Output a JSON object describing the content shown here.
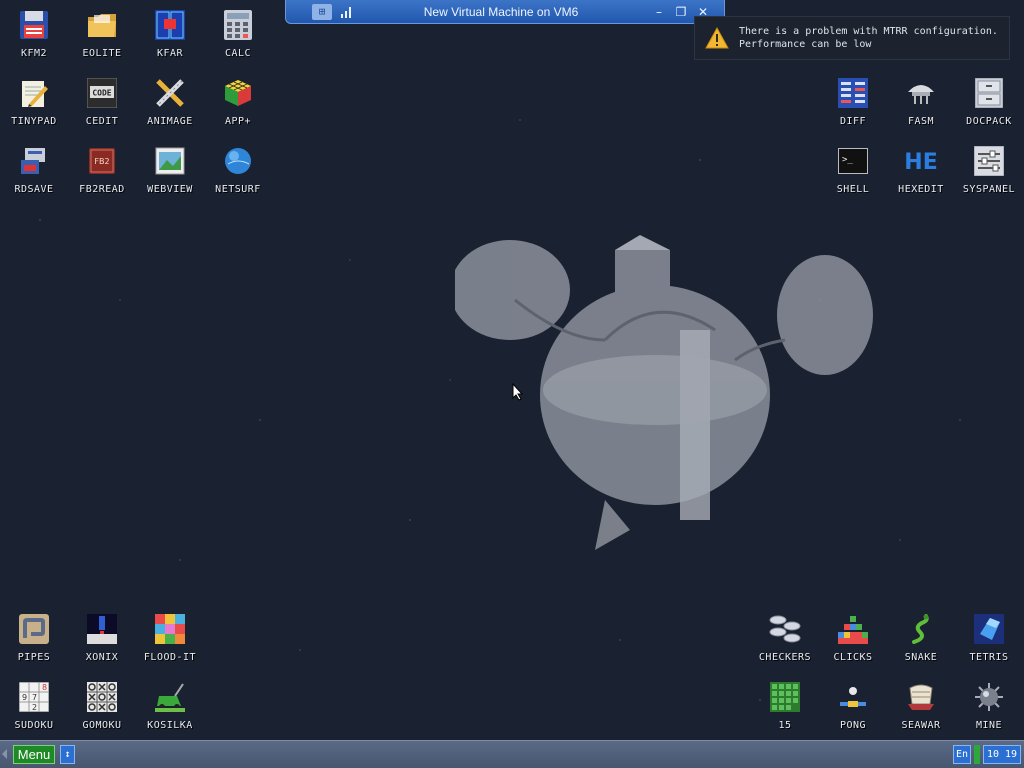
{
  "window": {
    "title": "New Virtual Machine on VM6"
  },
  "notification": {
    "line1": "There is a problem with MTRR configuration.",
    "line2": "Performance can be low"
  },
  "icons": {
    "kfm2": "KFM2",
    "eolite": "EOLITE",
    "kfar": "KFAR",
    "calc": "CALC",
    "tinypad": "TINYPAD",
    "cedit": "CEDIT",
    "animage": "ANIMAGE",
    "appplus": "APP+",
    "rdsave": "RDSAVE",
    "fb2read": "FB2READ",
    "webview": "WEBVIEW",
    "netsurf": "NETSURF",
    "diff": "DIFF",
    "fasm": "FASM",
    "docpack": "DOCPACK",
    "shell": "SHELL",
    "hexedit": "HEXEDIT",
    "syspanel": "SYSPANEL",
    "pipes": "PIPES",
    "xonix": "XONIX",
    "floodit": "FLOOD-IT",
    "sudoku": "SUDOKU",
    "gomoku": "GOMOKU",
    "kosilka": "KOSILKA",
    "checkers": "CHECKERS",
    "clicks": "CLICKS",
    "snake": "SNAKE",
    "tetris": "TETRIS",
    "fifteen": "15",
    "pong": "PONG",
    "seawar": "SEAWAR",
    "mine": "MINE"
  },
  "taskbar": {
    "menu_label": "Menu",
    "lang": "En",
    "clock": "10 19"
  },
  "colors": {
    "desktop_bg": "#1a2130",
    "titlebar": "#2158ad",
    "menu_button": "#1d8a25",
    "taskbar": "#48566f"
  }
}
